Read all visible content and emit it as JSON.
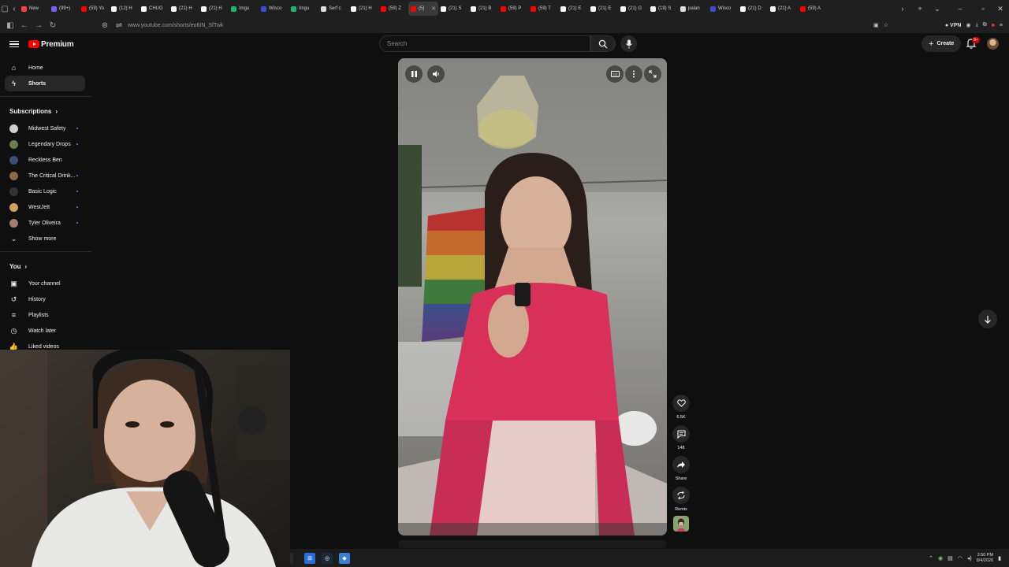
{
  "browser": {
    "tabs": [
      {
        "title": "New",
        "color": "#ff4040"
      },
      {
        "title": "(99+)",
        "color": "#7b5cff"
      },
      {
        "title": "(59) Yo",
        "color": "#ff0000"
      },
      {
        "title": "(12) H",
        "color": "#ffffff"
      },
      {
        "title": "CHUG",
        "color": "#ffffff"
      },
      {
        "title": "(21) H",
        "color": "#ffffff"
      },
      {
        "title": "(21) H",
        "color": "#ffffff"
      },
      {
        "title": "Imgu",
        "color": "#1bb76e"
      },
      {
        "title": "Wisco",
        "color": "#3a4bd8"
      },
      {
        "title": "Imgu",
        "color": "#1bb76e"
      },
      {
        "title": "Serf c",
        "color": "#dddddd"
      },
      {
        "title": "(21) H",
        "color": "#ffffff"
      },
      {
        "title": "(59) Z",
        "color": "#ff0000"
      },
      {
        "title": "(5)",
        "color": "#ff0000",
        "active": true
      },
      {
        "title": "(21) S",
        "color": "#ffffff"
      },
      {
        "title": "(21) B",
        "color": "#ffffff"
      },
      {
        "title": "(59) P",
        "color": "#ff0000"
      },
      {
        "title": "(59) T",
        "color": "#ff0000"
      },
      {
        "title": "(21) E",
        "color": "#ffffff"
      },
      {
        "title": "(21) E",
        "color": "#ffffff"
      },
      {
        "title": "(21) G",
        "color": "#ffffff"
      },
      {
        "title": "(19) S",
        "color": "#ffffff"
      },
      {
        "title": "palan",
        "color": "#dddddd"
      },
      {
        "title": "Wisco",
        "color": "#3a4bd8"
      },
      {
        "title": "(21) D",
        "color": "#ffffff"
      },
      {
        "title": "(21) A",
        "color": "#ffffff"
      },
      {
        "title": "(59) A",
        "color": "#ff0000"
      }
    ],
    "url": "www.youtube.com/shorts/eo6IN_SfTwk",
    "vpn_label": "VPN"
  },
  "masthead": {
    "brand": "Premium",
    "search_placeholder": "Search",
    "create_label": "Create",
    "notifications": "9+"
  },
  "sidebar": {
    "main": [
      {
        "label": "Home",
        "icon": "home-icon",
        "glyph": "⌂"
      },
      {
        "label": "Shorts",
        "icon": "shorts-icon",
        "glyph": "ϟ",
        "active": true
      }
    ],
    "subscriptions_heading": "Subscriptions",
    "subscriptions": [
      {
        "label": "Midwest Safety",
        "color": "#cfcfcf",
        "dot": true
      },
      {
        "label": "Legendary Drops",
        "color": "#6b7d4a",
        "dot": true
      },
      {
        "label": "Reckless Ben",
        "color": "#3c4d7a",
        "dot": false
      },
      {
        "label": "The Critical Drink...",
        "color": "#8a6a4a",
        "dot": true
      },
      {
        "label": "Basic Logic",
        "color": "#333333",
        "dot": true
      },
      {
        "label": "WestJett",
        "color": "#d0a060",
        "dot": true
      },
      {
        "label": "Tyler Oliveira",
        "color": "#a08070",
        "dot": true
      }
    ],
    "show_more": "Show more",
    "you_heading": "You",
    "you": [
      {
        "label": "Your channel",
        "icon": "channel-icon",
        "glyph": "▣"
      },
      {
        "label": "History",
        "icon": "history-icon",
        "glyph": "↺"
      },
      {
        "label": "Playlists",
        "icon": "playlists-icon",
        "glyph": "≡"
      },
      {
        "label": "Watch later",
        "icon": "watch-later-icon",
        "glyph": "◷"
      },
      {
        "label": "Liked videos",
        "icon": "like-icon",
        "glyph": "👍"
      }
    ]
  },
  "actions": {
    "likes": "6.5K",
    "comments": "148",
    "share": "Share",
    "remix": "Remix"
  },
  "taskbar": {
    "time": "3:50 PM",
    "date": "8/4/2026"
  }
}
